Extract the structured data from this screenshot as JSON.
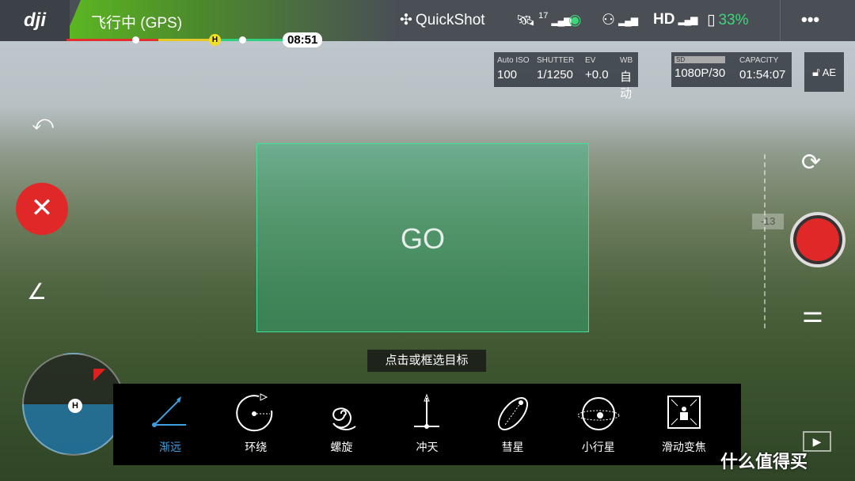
{
  "topbar": {
    "logo": "dji",
    "flight_status": "飞行中 (GPS)",
    "flight_time": "08:51",
    "home_marker": "H",
    "quickshot": "QuickShot",
    "satellites": "17",
    "hd": "HD",
    "battery": "33%",
    "more": "•••",
    "battery_color": "#3fd67a"
  },
  "camera": {
    "iso_label": "Auto ISO",
    "iso": "100",
    "shutter_label": "SHUTTER",
    "shutter": "1/1250",
    "ev_label": "EV",
    "ev": "+0.0",
    "wb_label": "WB",
    "wb": "自动",
    "sd_label": "SD",
    "resolution": "1080P/30",
    "capacity_label": "CAPACITY",
    "capacity": "01:54:07",
    "ae": "AE"
  },
  "target": {
    "go": "GO",
    "hint": "点击或框选目标"
  },
  "gimbal": {
    "angle": "-13"
  },
  "compass": {
    "home": "H"
  },
  "modes": [
    {
      "label": "渐远",
      "active": true
    },
    {
      "label": "环绕"
    },
    {
      "label": "螺旋"
    },
    {
      "label": "冲天"
    },
    {
      "label": "彗星"
    },
    {
      "label": "小行星"
    },
    {
      "label": "滑动变焦"
    }
  ],
  "watermark": "什么值得买",
  "accent": "#3b9fe0"
}
